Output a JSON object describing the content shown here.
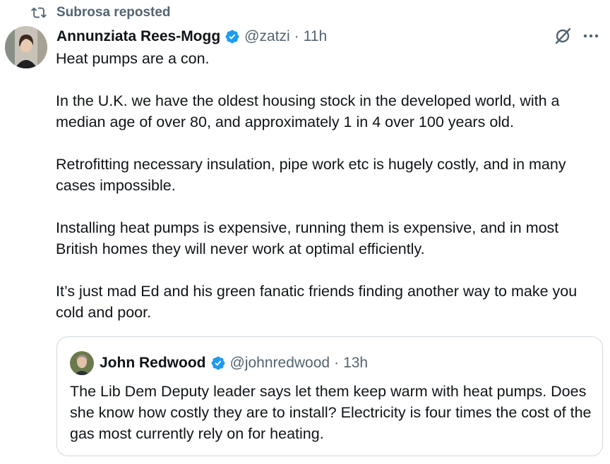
{
  "repost": {
    "label": "Subrosa reposted"
  },
  "tweet": {
    "author_name": "Annunziata Rees-Mogg",
    "handle": "@zatzi",
    "separator": "·",
    "time": "11h",
    "paragraphs": [
      "Heat pumps are a con.",
      "In the U.K. we have the oldest housing stock in the developed world, with a median age of over 80, and approximately 1 in 4 over 100 years old.",
      "Retrofitting necessary insulation, pipe work etc is hugely costly, and in many cases impossible.",
      "Installing heat pumps is expensive, running them is expensive, and in most British homes they will never work at optimal efficiently.",
      "It’s just mad Ed and his green fanatic friends finding another way to make you cold and poor."
    ]
  },
  "quote": {
    "author_name": "John Redwood",
    "handle": "@johnredwood",
    "separator": "·",
    "time": "13h",
    "text": "The Lib Dem Deputy leader says let them keep warm with heat pumps. Does she know how costly they are to install? Electricity  is four times the cost of the gas most currently rely on for heating."
  },
  "icons": {
    "repost": "repost-icon",
    "verified": "verified-badge-icon",
    "grok": "grok-icon",
    "more": "more-icon"
  },
  "colors": {
    "verified": "#1d9bf0",
    "secondary_text": "#536471",
    "border": "#cfd9de"
  }
}
